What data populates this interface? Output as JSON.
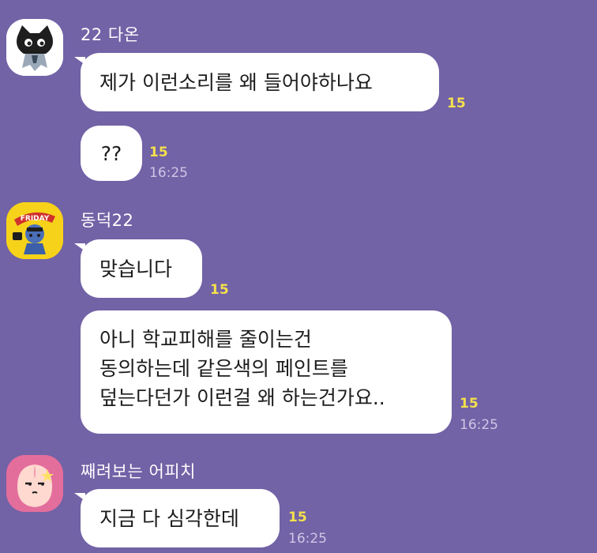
{
  "messages": [
    {
      "sender": "22 다온",
      "avatar_icon": "kakao-cat-avatar-icon",
      "bubbles": [
        {
          "text": "제가 이런소리를 왜 들어야하나요",
          "unread": "15",
          "time": ""
        },
        {
          "text": "??",
          "unread": "15",
          "time": "16:25"
        }
      ]
    },
    {
      "sender": "동덕22",
      "avatar_icon": "kakao-friday-avatar-icon",
      "bubbles": [
        {
          "text": "맞습니다",
          "unread": "15",
          "time": ""
        },
        {
          "text": "아니 학교피해를 줄이는건\n동의하는데 같은색의 페인트를\n덮는다던가 이런걸 왜 하는건가요..",
          "unread": "15",
          "time": "16:25"
        }
      ]
    },
    {
      "sender": "째려보는 어피치",
      "avatar_icon": "kakao-apeach-avatar-icon",
      "bubbles": [
        {
          "text": "지금 다 심각한데",
          "unread": "15",
          "time": "16:25"
        }
      ]
    }
  ],
  "colors": {
    "background": "#7262a6",
    "bubble": "#ffffff",
    "unread": "#f4e04d",
    "time": "#cfc6e6"
  }
}
